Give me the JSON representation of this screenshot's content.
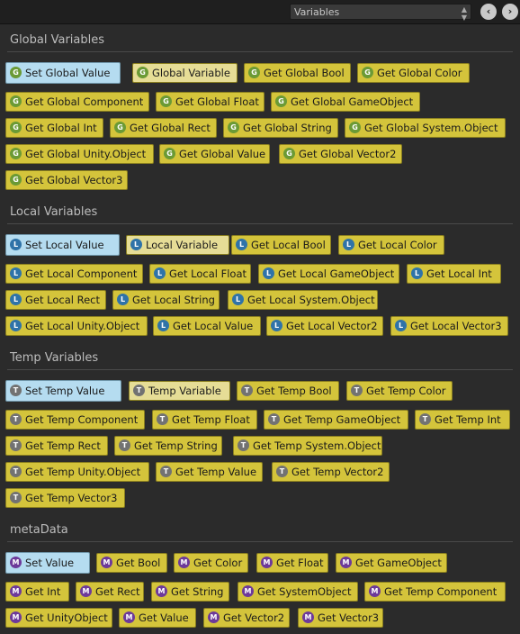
{
  "toolbar": {
    "dropdown_value": "Variables",
    "back_icon": "chevron-left-icon",
    "forward_icon": "chevron-right-icon"
  },
  "colors": {
    "background": "#2b2b2b",
    "node_yellow": "#d4c43b",
    "node_light": "#e6dd96",
    "setter_blue": "#b5dcf0"
  },
  "sections": {
    "global": {
      "title": "Global Variables",
      "icon_letter": "G",
      "items": [
        "Set Global Value",
        "Global Variable",
        "Get Global Bool",
        "Get Global Color",
        "Get Global Component",
        "Get Global Float",
        "Get Global GameObject",
        "Get Global Int",
        "Get Global Rect",
        "Get Global String",
        "Get Global System.Object",
        "Get Global Unity.Object",
        "Get Global Value",
        "Get Global Vector2",
        "Get Global Vector3"
      ]
    },
    "local": {
      "title": "Local Variables",
      "icon_letter": "L",
      "items": [
        "Set Local Value",
        "Local Variable",
        "Get Local Bool",
        "Get Local Color",
        "Get Local Component",
        "Get Local Float",
        "Get Local GameObject",
        "Get Local Int",
        "Get Local Rect",
        "Get Local String",
        "Get Local System.Object",
        "Get Local Unity.Object",
        "Get Local Value",
        "Get Local Vector2",
        "Get Local Vector3"
      ]
    },
    "temp": {
      "title": "Temp Variables",
      "icon_letter": "T",
      "items": [
        "Set Temp Value",
        "Temp Variable",
        "Get Temp Bool",
        "Get Temp Color",
        "Get Temp Component",
        "Get Temp Float",
        "Get Temp GameObject",
        "Get Temp Int",
        "Get Temp Rect",
        "Get Temp String",
        "Get Temp System.Object",
        "Get Temp Unity.Object",
        "Get Temp Value",
        "Get Temp Vector2",
        "Get Temp Vector3"
      ]
    },
    "meta": {
      "title": "metaData",
      "icon_letter": "M",
      "items": [
        "Set Value",
        "Get Bool",
        "Get Color",
        "Get Float",
        "Get GameObject",
        "Get Int",
        "Get Rect",
        "Get String",
        "Get SystemObject",
        "Get Temp Component",
        "Get UnityObject",
        "Get Value",
        "Get Vector2",
        "Get Vector3"
      ]
    }
  }
}
